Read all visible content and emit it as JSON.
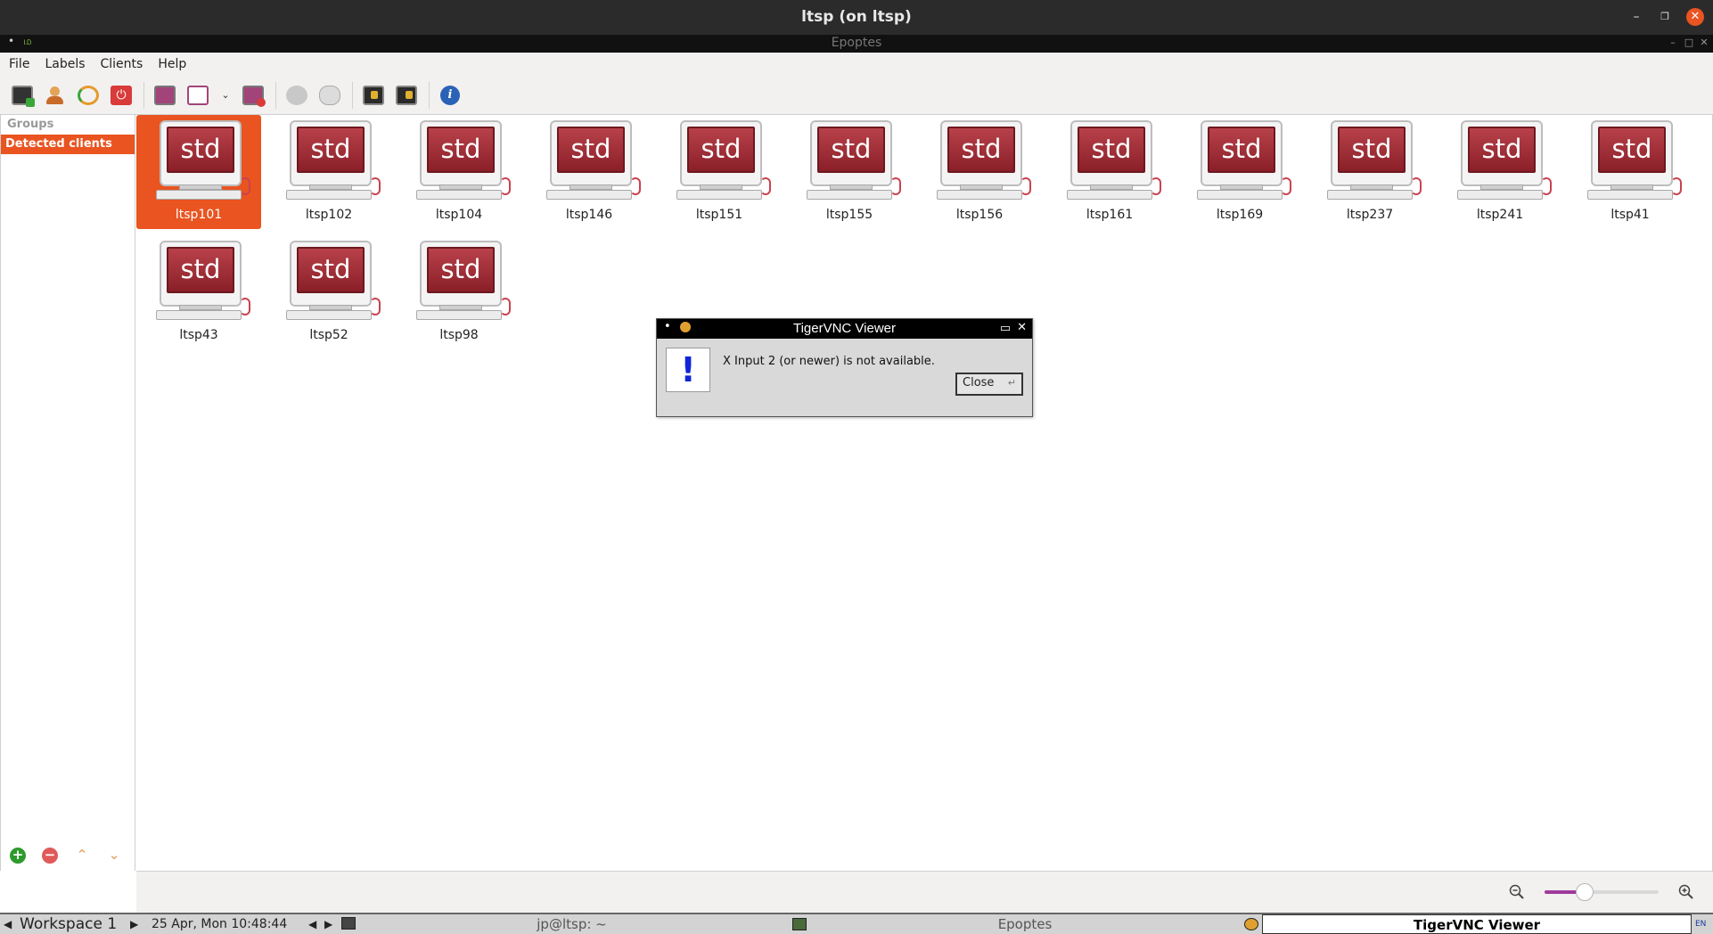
{
  "window": {
    "title": "ltsp (on ltsp)",
    "inner_title": "Epoptes",
    "inner_glyph": "ம"
  },
  "menu": [
    "File",
    "Labels",
    "Clients",
    "Help"
  ],
  "toolbar_icons": [
    "connect-icon",
    "user-icon",
    "reboot-icon",
    "power-icon",
    "broadcast-icon",
    "broadcast-windowed-icon",
    "dropdown-icon",
    "stop-broadcast-icon",
    "execute-icon",
    "send-message-icon",
    "lock-screen-icon",
    "unlock-screen-icon",
    "info-icon"
  ],
  "sidebar": {
    "header": "Groups",
    "items": [
      "Detected clients"
    ]
  },
  "client_icon_label": "std",
  "clients": [
    {
      "name": "ltsp101",
      "selected": true
    },
    {
      "name": "ltsp102"
    },
    {
      "name": "ltsp104"
    },
    {
      "name": "ltsp146"
    },
    {
      "name": "ltsp151"
    },
    {
      "name": "ltsp155"
    },
    {
      "name": "ltsp156"
    },
    {
      "name": "ltsp161"
    },
    {
      "name": "ltsp169"
    },
    {
      "name": "ltsp237"
    },
    {
      "name": "ltsp241"
    },
    {
      "name": "ltsp41"
    },
    {
      "name": "ltsp43"
    },
    {
      "name": "ltsp52"
    },
    {
      "name": "ltsp98"
    }
  ],
  "zoom": {
    "level": 0.35
  },
  "dialog": {
    "title": "TigerVNC Viewer",
    "icon_glyph": "!",
    "message": "X Input 2 (or newer) is not available.",
    "button": "Close"
  },
  "taskbar": {
    "workspace": "Workspace 1",
    "datetime": "25 Apr, Mon 10:48:44",
    "tasks": [
      "jp@ltsp: ~",
      "Epoptes",
      "TigerVNC Viewer"
    ],
    "lang": "EN"
  },
  "colors": {
    "accent": "#e95420",
    "zoom_fill": "#a03a9c"
  }
}
